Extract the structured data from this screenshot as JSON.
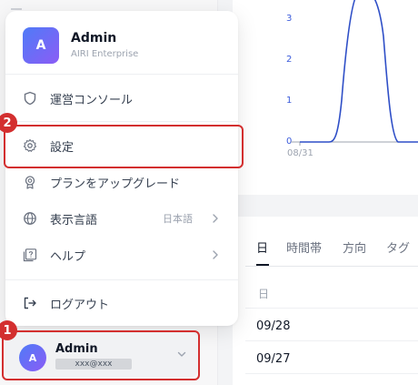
{
  "chart": {
    "y_ticks": [
      "3",
      "2",
      "1",
      "0"
    ],
    "x_tick": "08/31"
  },
  "tabs": [
    "日",
    "時間帯",
    "方向",
    "タグ"
  ],
  "table": {
    "column_header": "日",
    "rows": [
      "09/28",
      "09/27"
    ]
  },
  "menu": {
    "user_name": "Admin",
    "plan": "AIRI Enterprise",
    "avatar_letter": "A",
    "items": [
      {
        "label": "運営コンソール",
        "icon": "shield-icon"
      },
      {
        "label": "設定",
        "icon": "gear-icon"
      },
      {
        "label": "プランをアップグレード",
        "icon": "badge-icon"
      },
      {
        "label": "表示言語",
        "icon": "globe-icon",
        "value": "日本語"
      },
      {
        "label": "ヘルプ",
        "icon": "help-icon"
      },
      {
        "label": "ログアウト",
        "icon": "logout-icon"
      }
    ]
  },
  "account": {
    "name": "Admin",
    "email": "xxx@xxx",
    "avatar_letter": "A"
  },
  "annotations": {
    "badge_1": "1",
    "badge_2": "2"
  },
  "colors": {
    "highlight": "#d32f2f",
    "chart_line": "#2f4fc7",
    "avatar_gradient_start": "#4f7bf7",
    "avatar_gradient_end": "#8b5cf6"
  }
}
